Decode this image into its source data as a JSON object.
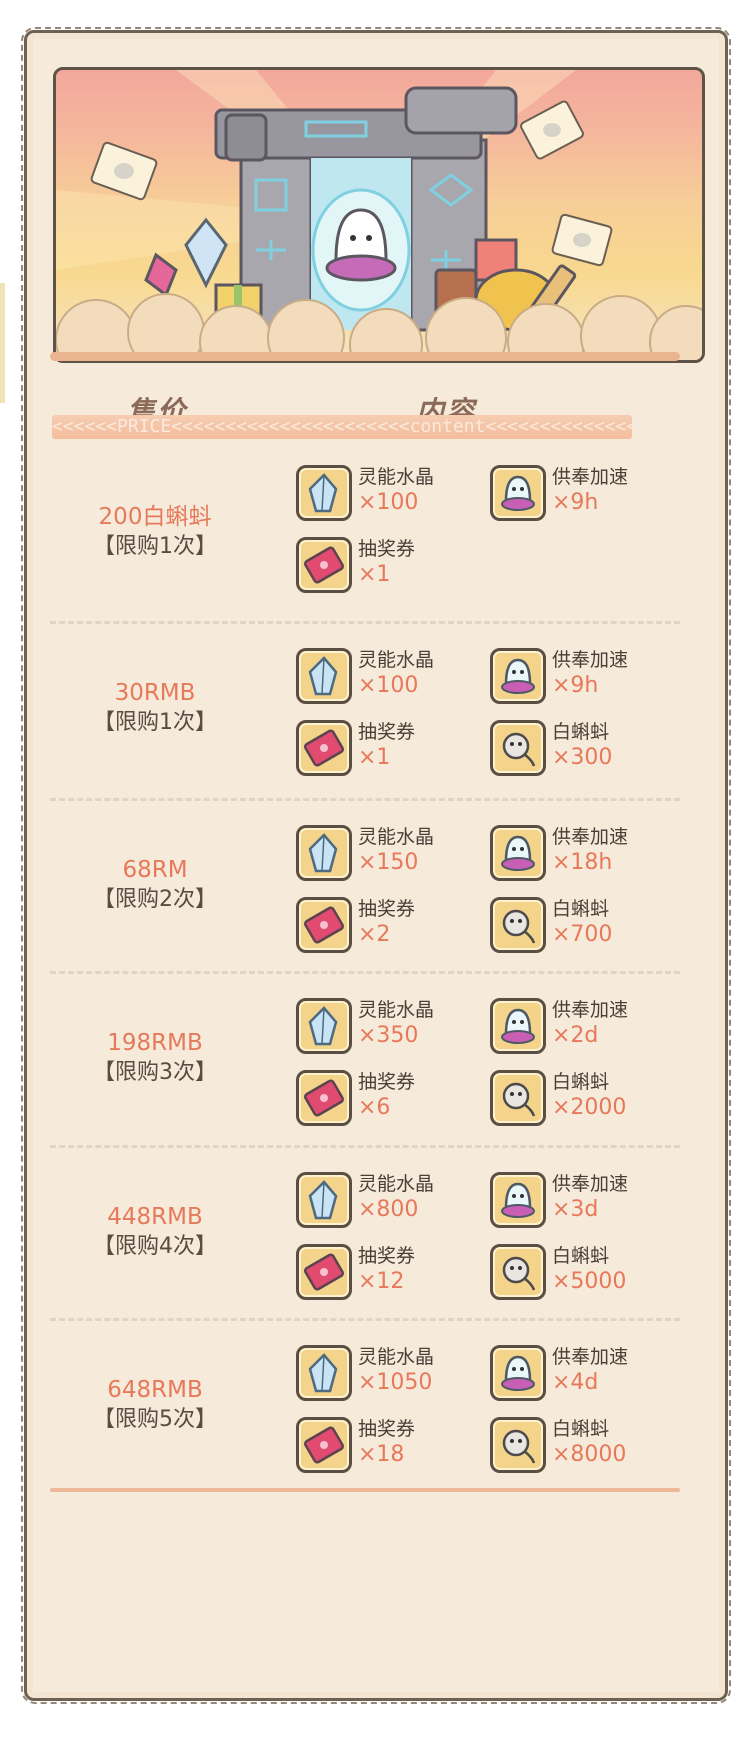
{
  "header": {
    "price_col": "售价",
    "content_col": "内容",
    "ribbon": "<<<<<<PRICE<<<<<<<<<<<<<<<<<<<<<<content<<<<<<<<<<<<<<"
  },
  "icons": {
    "crystal": "crystal-icon",
    "ghost_speedup": "ghost-speedup-icon",
    "ticket": "ticket-icon",
    "tadpole": "tadpole-icon"
  },
  "colors": {
    "price_text": "#e7795a",
    "icon_bg": "#f3d48a",
    "paper": "#f6eadb",
    "accent_bar": "#eab48e"
  },
  "packages": [
    {
      "price": "200白蝌蚪",
      "limit": "【限购1次】",
      "items": [
        {
          "name": "灵能水晶",
          "qty": "×100",
          "icon": "crystal"
        },
        {
          "name": "供奉加速",
          "qty": "×9h",
          "icon": "ghost"
        },
        {
          "name": "抽奖券",
          "qty": "×1",
          "icon": "ticket"
        }
      ]
    },
    {
      "price": "30RMB",
      "limit": "【限购1次】",
      "items": [
        {
          "name": "灵能水晶",
          "qty": "×100",
          "icon": "crystal"
        },
        {
          "name": "供奉加速",
          "qty": "×9h",
          "icon": "ghost"
        },
        {
          "name": "抽奖券",
          "qty": "×1",
          "icon": "ticket"
        },
        {
          "name": "白蝌蚪",
          "qty": "×300",
          "icon": "tadpole"
        }
      ]
    },
    {
      "price": "68RM",
      "limit": "【限购2次】",
      "items": [
        {
          "name": "灵能水晶",
          "qty": "×150",
          "icon": "crystal"
        },
        {
          "name": "供奉加速",
          "qty": "×18h",
          "icon": "ghost"
        },
        {
          "name": "抽奖券",
          "qty": "×2",
          "icon": "ticket"
        },
        {
          "name": "白蝌蚪",
          "qty": "×700",
          "icon": "tadpole"
        }
      ]
    },
    {
      "price": "198RMB",
      "limit": "【限购3次】",
      "items": [
        {
          "name": "灵能水晶",
          "qty": "×350",
          "icon": "crystal"
        },
        {
          "name": "供奉加速",
          "qty": "×2d",
          "icon": "ghost"
        },
        {
          "name": "抽奖券",
          "qty": "×6",
          "icon": "ticket"
        },
        {
          "name": "白蝌蚪",
          "qty": "×2000",
          "icon": "tadpole"
        }
      ]
    },
    {
      "price": "448RMB",
      "limit": "【限购4次】",
      "items": [
        {
          "name": "灵能水晶",
          "qty": "×800",
          "icon": "crystal"
        },
        {
          "name": "供奉加速",
          "qty": "×3d",
          "icon": "ghost"
        },
        {
          "name": "抽奖券",
          "qty": "×12",
          "icon": "ticket"
        },
        {
          "name": "白蝌蚪",
          "qty": "×5000",
          "icon": "tadpole"
        }
      ]
    },
    {
      "price": "648RMB",
      "limit": "【限购5次】",
      "items": [
        {
          "name": "灵能水晶",
          "qty": "×1050",
          "icon": "crystal"
        },
        {
          "name": "供奉加速",
          "qty": "×4d",
          "icon": "ghost"
        },
        {
          "name": "抽奖券",
          "qty": "×18",
          "icon": "ticket"
        },
        {
          "name": "白蝌蚪",
          "qty": "×8000",
          "icon": "tadpole"
        }
      ]
    }
  ]
}
